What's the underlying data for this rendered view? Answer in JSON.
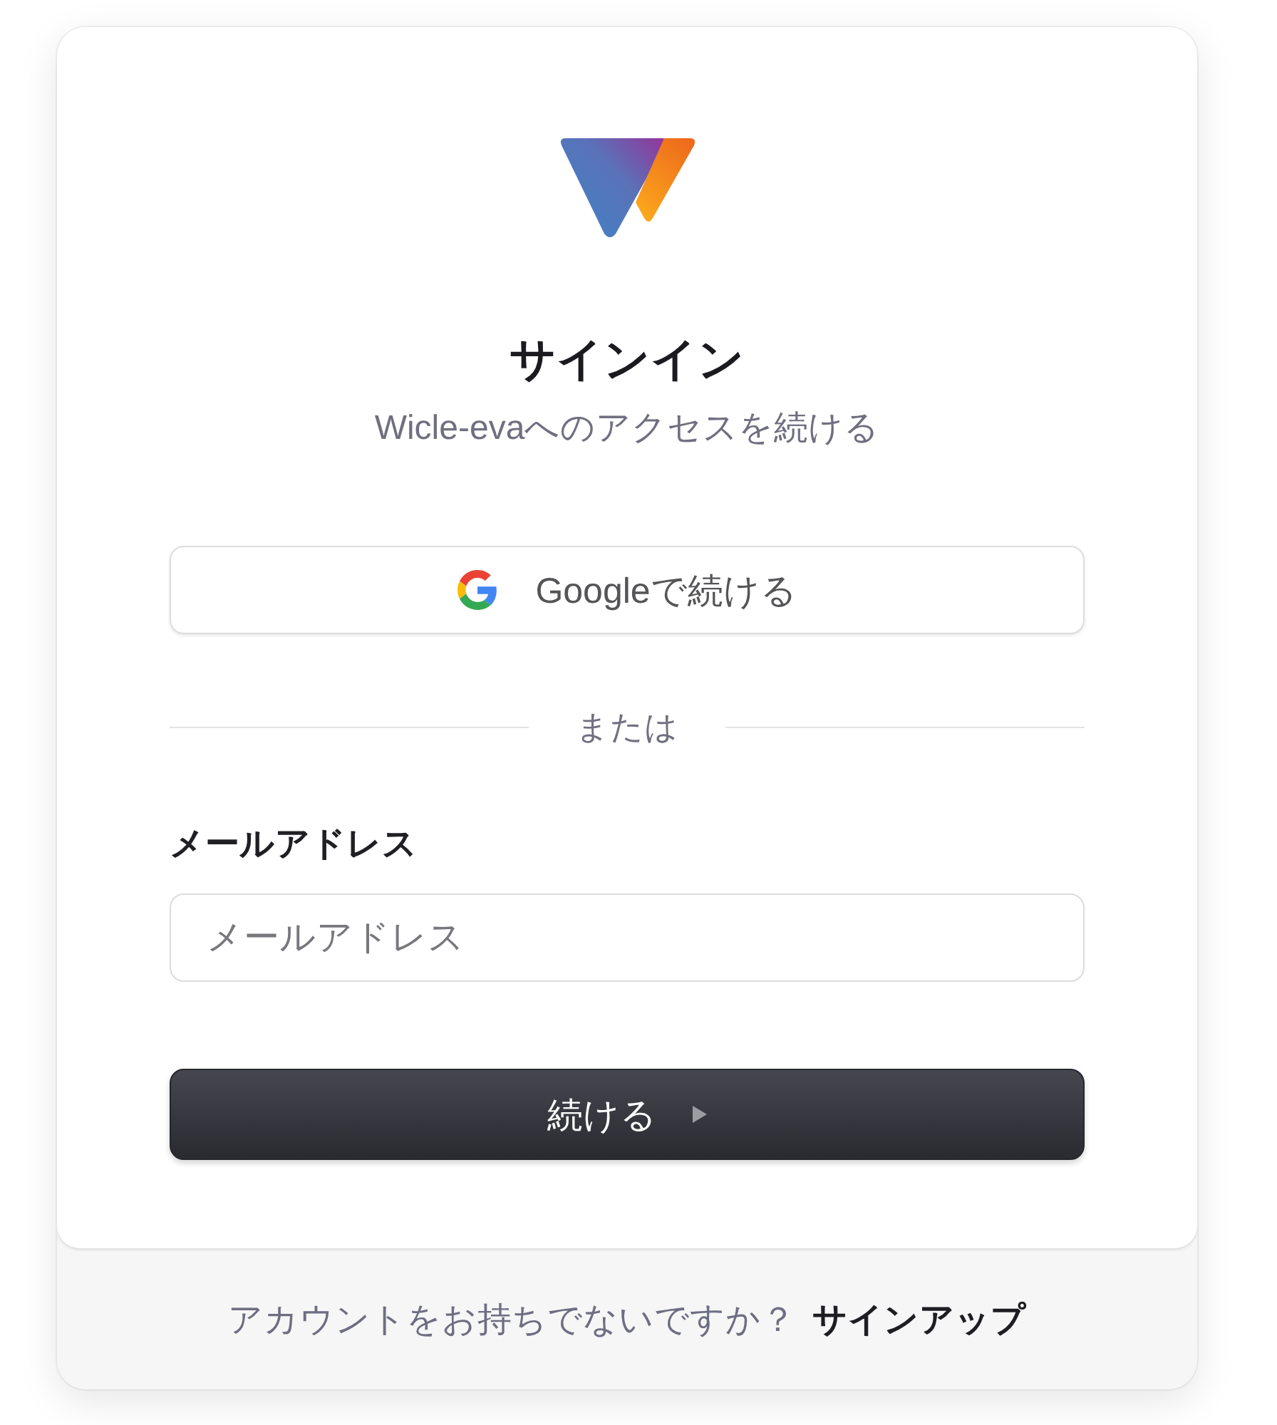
{
  "heading": {
    "title": "サインイン",
    "subtitle": "Wicle-evaへのアクセスを続ける"
  },
  "google_button": {
    "label": "Googleで続ける"
  },
  "divider": {
    "label": "または"
  },
  "email": {
    "label": "メールアドレス",
    "placeholder": "メールアドレス"
  },
  "submit_button": {
    "label": "続ける"
  },
  "footer": {
    "prompt": "アカウントをお持ちでないですか？",
    "link": "サインアップ"
  }
}
